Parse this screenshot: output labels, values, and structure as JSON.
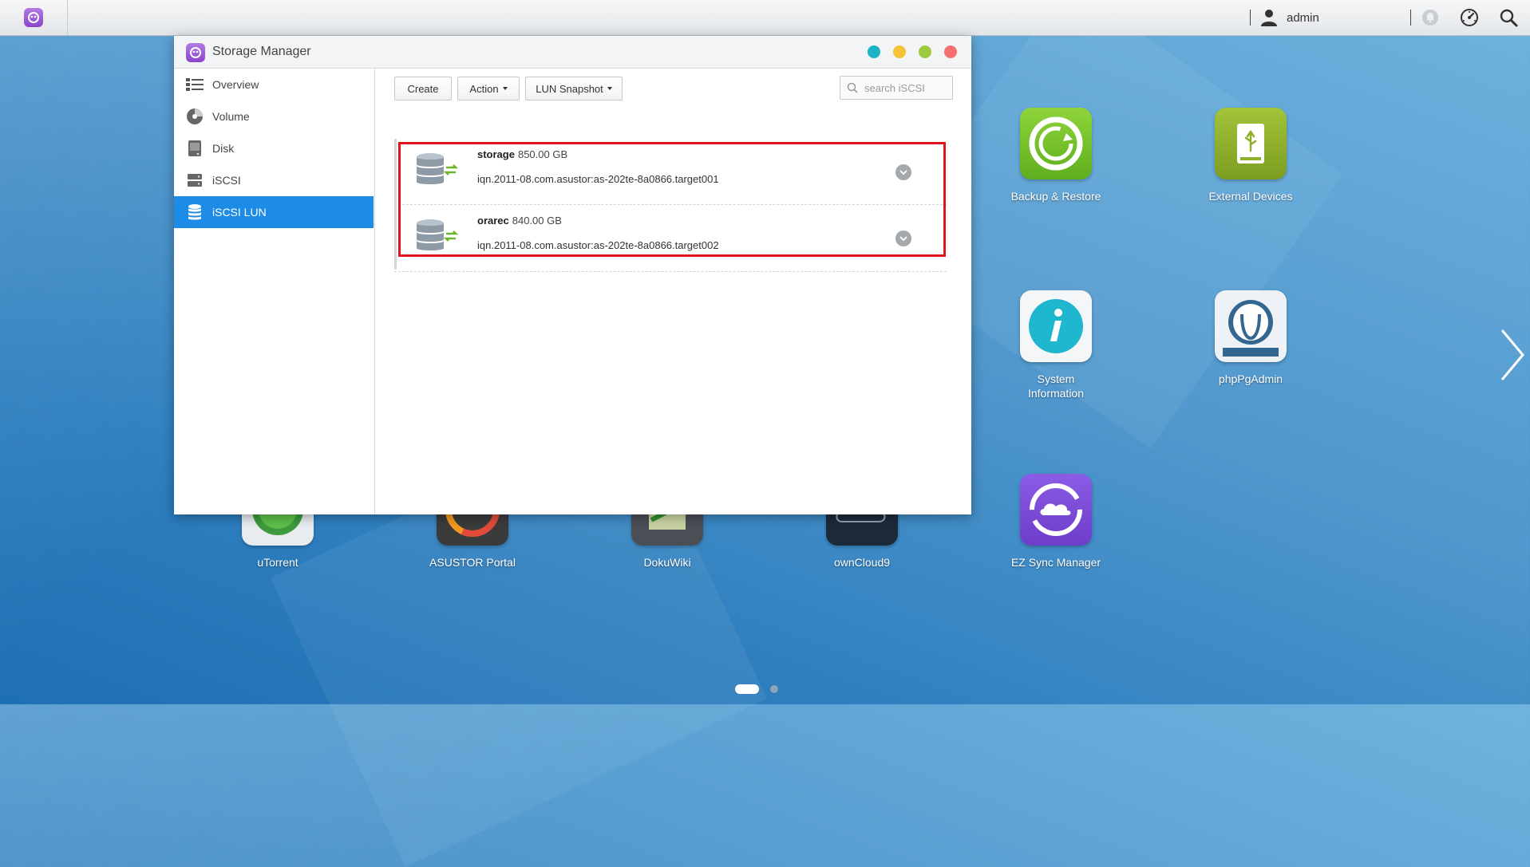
{
  "topbar": {
    "user": "admin"
  },
  "window": {
    "title": "Storage Manager",
    "controls": {
      "colors": [
        "#1bb3c5",
        "#f5c335",
        "#9ccc3d",
        "#f56f6f"
      ]
    }
  },
  "sidebar": {
    "items": [
      {
        "label": "Overview",
        "icon": "overview-icon"
      },
      {
        "label": "Volume",
        "icon": "volume-icon"
      },
      {
        "label": "Disk",
        "icon": "disk-icon"
      },
      {
        "label": "iSCSI",
        "icon": "iscsi-icon"
      },
      {
        "label": "iSCSI LUN",
        "icon": "database-icon",
        "active": true
      }
    ]
  },
  "toolbar": {
    "create_label": "Create",
    "action_label": "Action",
    "snapshot_label": "LUN Snapshot",
    "search_placeholder": "search iSCSI"
  },
  "luns": [
    {
      "name": "storage",
      "size": "850.00 GB",
      "iqn": "iqn.2011-08.com.asustor:as-202te-8a0866.target001"
    },
    {
      "name": "orarec",
      "size": "840.00 GB",
      "iqn": "iqn.2011-08.com.asustor:as-202te-8a0866.target002"
    }
  ],
  "desktop": {
    "apps": [
      {
        "label": "Backup & Restore",
        "color": "#7cc22b"
      },
      {
        "label": "External Devices",
        "color": "#8db02a"
      },
      {
        "label": "System\nInformation",
        "color": "#1fb7cf"
      },
      {
        "label": "phpPgAdmin",
        "color": "#e9eef3"
      },
      {
        "label": "uTorrent",
        "color": "#3d9a3d"
      },
      {
        "label": "ASUSTOR Portal",
        "color": "#3b3b3b"
      },
      {
        "label": "DokuWiki",
        "color": "#4a4e55"
      },
      {
        "label": "ownCloud9",
        "color": "#1c2a3a"
      },
      {
        "label": "EZ Sync Manager",
        "color": "#7a49d8"
      }
    ],
    "page_indicator": {
      "current": 1,
      "total": 2
    }
  }
}
